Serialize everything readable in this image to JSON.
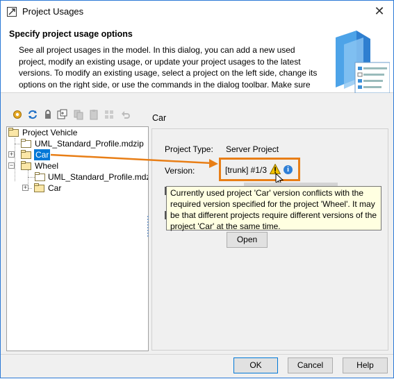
{
  "window": {
    "title": "Project Usages",
    "close_glyph": "✕"
  },
  "header": {
    "heading": "Specify project usage options",
    "description": "See all project usages in the model. In this dialog, you can add a new used project, modify an existing usage, or update your project usages to the latest versions. To modify an existing usage, select a project on the left side, change its options on the right side, or use the commands in the dialog toolbar. Make sure you lock the"
  },
  "toolbar": {
    "icons": [
      "gear-icon",
      "refresh-icon",
      "lock-icon",
      "import-icon",
      "copy-icon",
      "paste-icon",
      "share-icon",
      "undo-icon"
    ]
  },
  "tree": {
    "root": {
      "label": "Project Vehicle"
    },
    "items": [
      {
        "label": "UML_Standard_Profile.mdzip"
      },
      {
        "label": "Car"
      },
      {
        "label": "Wheel"
      },
      {
        "label": "UML_Standard_Profile.mdz"
      },
      {
        "label": "Car"
      }
    ]
  },
  "details": {
    "title": "Car",
    "project_type_label": "Project Type:",
    "project_type_value": "Server Project",
    "version_label": "Version:",
    "version_value": "[trunk] #1/3",
    "info_glyph": "i",
    "open_label": "Open"
  },
  "tooltip": {
    "text": "Currently used project 'Car' version conflicts with the required version specified for the project 'Wheel'. It may be that different projects require different versions of the project 'Car' at the same time."
  },
  "buttons": {
    "ok": "OK",
    "cancel": "Cancel",
    "help": "Help"
  },
  "colors": {
    "accent": "#0078d7",
    "highlight": "#e87e16",
    "tooltip_bg": "#ffffe1"
  }
}
